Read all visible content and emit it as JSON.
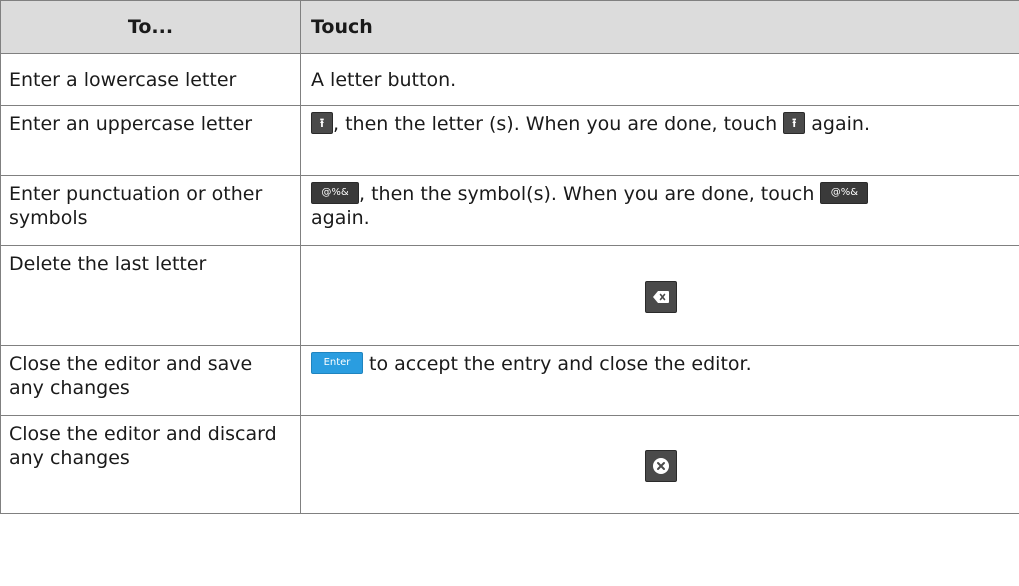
{
  "header": {
    "col1": "To...",
    "col2": "Touch"
  },
  "rows": [
    {
      "action": "Enter a lowercase letter",
      "touch_text": "A letter button."
    },
    {
      "action": "Enter an uppercase letter",
      "touch_text_before": "",
      "touch_text_mid": ", then the letter (s). When you are done, touch ",
      "touch_text_after": " again.",
      "icon": "shift-up-arrow-icon"
    },
    {
      "action": "Enter punctuation or other symbols",
      "button_label": "@%&",
      "touch_text_mid": ", then the symbol(s). When you are done, touch ",
      "touch_text_after": " again."
    },
    {
      "action": "Delete the last letter",
      "icon": "backspace-icon"
    },
    {
      "action": "Close the editor and save any changes",
      "button_label": "Enter",
      "touch_text_after": " to accept the entry and close the editor.",
      "button_color": "#2a9de0"
    },
    {
      "action": "Close the editor and discard any changes",
      "icon": "close-circle-icon"
    }
  ],
  "colors": {
    "header_bg": "#dcdcdc",
    "button_dark": "#4a4a4a",
    "button_enter": "#2a9de0",
    "border": "#808080"
  }
}
